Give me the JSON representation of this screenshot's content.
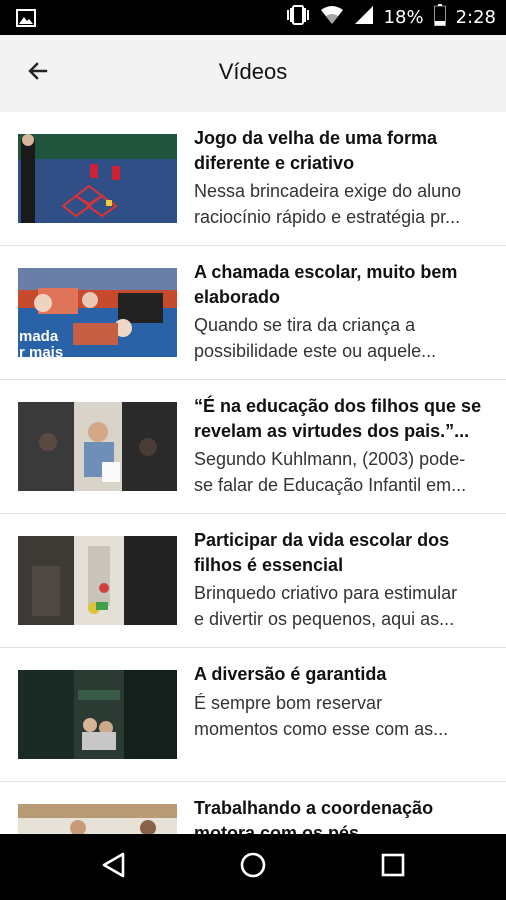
{
  "status_bar": {
    "battery_percent": "18%",
    "time": "2:28",
    "icons": [
      "image-icon",
      "vibrate-icon",
      "wifi-icon",
      "signal-icon",
      "battery-icon"
    ]
  },
  "header": {
    "title": "Vídeos",
    "back_icon": "arrow-back-icon"
  },
  "videos": [
    {
      "title": "Jogo da velha de uma forma diferente e criativo",
      "title_lines": [
        "Jogo da velha de uma forma",
        "diferente e criativo"
      ],
      "desc_lines": [
        "Nessa brincadeira exige do aluno",
        "raciocínio rápido e estratégia pr..."
      ]
    },
    {
      "title": "A chamada escolar, muito bem elaborado",
      "title_lines": [
        "A chamada escolar, muito bem",
        "elaborado"
      ],
      "desc_lines": [
        "Quando se tira da criança a",
        "possibilidade este ou aquele..."
      ],
      "thumb_caption": [
        "mada",
        "r mais"
      ]
    },
    {
      "title": "“É na educação dos filhos que se revelam as virtudes dos pais.”...",
      "title_lines": [
        "“É na educação dos filhos que se",
        "revelam as virtudes dos pais.”..."
      ],
      "desc_lines": [
        "Segundo Kuhlmann, (2003) pode-",
        "se falar de Educação Infantil em..."
      ]
    },
    {
      "title": "Participar da vida escolar dos filhos é essencial",
      "title_lines": [
        "Participar da vida escolar dos",
        "filhos é essencial"
      ],
      "desc_lines": [
        "Brinquedo criativo para estimular",
        "e divertir os pequenos, aqui as..."
      ]
    },
    {
      "title": "A diversão é garantida",
      "title_lines": [
        "A diversão é garantida"
      ],
      "desc_lines": [
        "É sempre bom reservar",
        "momentos como esse com as..."
      ]
    },
    {
      "title": "Trabalhando a coordenação motora com os pés",
      "title_lines": [
        "Trabalhando a coordenação",
        "motora com os pés"
      ],
      "desc_lines": []
    }
  ],
  "navigation": {
    "back": "nav-back-icon",
    "home": "nav-home-icon",
    "recents": "nav-recents-icon"
  },
  "colors": {
    "app_bar": "#f3f3f3",
    "status_bar": "#000000",
    "nav_bar": "#000000",
    "title_text": "#111111",
    "desc_text": "#333333"
  }
}
